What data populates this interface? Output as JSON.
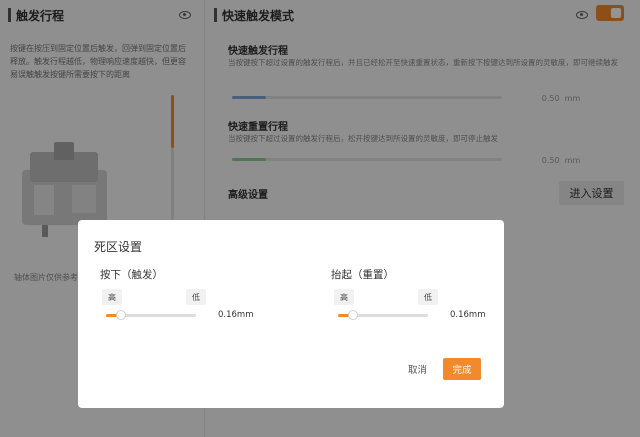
{
  "left_panel": {
    "title": "触发行程",
    "description": "按键在按压到固定位置后触发，回弹到固定位置后释放。触发行程越低，物理响应速度越快，但更容易误触触发按键所需要按下的距离",
    "image_note": "轴体图片仅供参考",
    "eye_icon": "eye-icon",
    "travel_level": 0.42
  },
  "right_panel": {
    "title": "快速触发模式",
    "toggle_on": true,
    "rapid_trigger": {
      "title": "快速触发行程",
      "description": "当按键按下超过设置的触发行程后，并且已经松开至快速重置状态，重新按下按键达到所设置的灵敏度，即可继续触发",
      "value": "0.50",
      "unit": "mm",
      "accent": "#7fa6d8"
    },
    "rapid_reset": {
      "title": "快速重置行程",
      "description": "当按键按下超过设置的触发行程后，松开按键达到所设置的灵敏度，即可停止触发",
      "value": "0.50",
      "unit": "mm",
      "accent": "#8cc98c"
    },
    "advanced": {
      "title": "高级设置",
      "button_label": "进入设置"
    }
  },
  "modal": {
    "title": "死区设置",
    "press": {
      "label": "按下（触发）",
      "high": "高",
      "low": "低",
      "value": "0.16mm"
    },
    "release": {
      "label": "抬起（重置）",
      "high": "高",
      "low": "低",
      "value": "0.16mm"
    },
    "cancel_label": "取消",
    "done_label": "完成",
    "accent": "#f08a2c"
  }
}
